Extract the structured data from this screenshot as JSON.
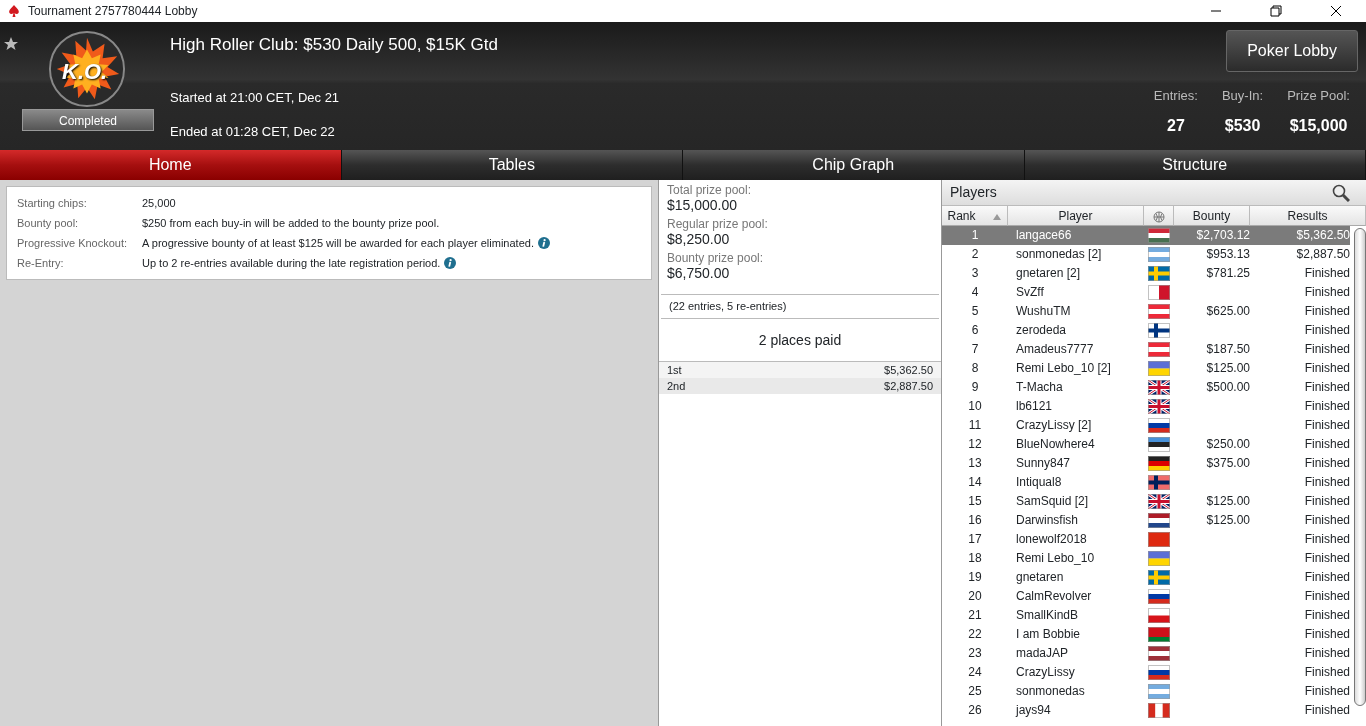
{
  "window": {
    "title": "Tournament 2757780444 Lobby"
  },
  "header": {
    "title": "High Roller Club: $530 Daily 500, $15K Gtd",
    "badge": "K.O.",
    "status": "Completed",
    "started": "Started at 21:00 CET, Dec 21",
    "ended": "Ended at 01:28 CET, Dec 22",
    "lobby_button": "Poker Lobby",
    "stats": [
      {
        "label": "Entries:",
        "value": "27"
      },
      {
        "label": "Buy-In:",
        "value": "$530"
      },
      {
        "label": "Prize Pool:",
        "value": "$15,000"
      }
    ]
  },
  "tabs": [
    {
      "label": "Home",
      "selected": true
    },
    {
      "label": "Tables",
      "selected": false
    },
    {
      "label": "Chip Graph",
      "selected": false
    },
    {
      "label": "Structure",
      "selected": false
    }
  ],
  "info": [
    {
      "label": "Starting chips:",
      "value": "25,000",
      "info_icon": false
    },
    {
      "label": "Bounty pool:",
      "value": "$250 from each buy-in will be added to the bounty prize pool.",
      "info_icon": false
    },
    {
      "label": "Progressive Knockout:",
      "value": "A progressive bounty of at least $125 will be awarded for each player eliminated.",
      "info_icon": true
    },
    {
      "label": "Re-Entry:",
      "value": "Up to 2 re-entries available during the late registration period.",
      "info_icon": true
    }
  ],
  "prizes": {
    "pools": [
      {
        "label": "Total prize pool:",
        "value": "$15,000.00"
      },
      {
        "label": "Regular prize pool:",
        "value": "$8,250.00"
      },
      {
        "label": "Bounty prize pool:",
        "value": "$6,750.00"
      }
    ],
    "entries_note": "(22 entries, 5 re-entries)",
    "places_paid": "2 places paid",
    "payouts": [
      {
        "place": "1st",
        "amount": "$5,362.50"
      },
      {
        "place": "2nd",
        "amount": "$2,887.50"
      }
    ]
  },
  "players": {
    "title": "Players",
    "columns": [
      "Rank",
      "Player",
      "Bounty",
      "Results"
    ],
    "rows": [
      {
        "rank": "1",
        "player": "langace66",
        "bounty": "$2,703.12",
        "result": "$5,362.50",
        "selected": true
      },
      {
        "rank": "2",
        "player": "sonmonedas [2]",
        "bounty": "$953.13",
        "result": "$2,887.50",
        "selected": false
      },
      {
        "rank": "3",
        "player": "gnetaren [2]",
        "bounty": "$781.25",
        "result": "Finished",
        "selected": false
      },
      {
        "rank": "4",
        "player": "SvZff",
        "result": "Finished",
        "selected": false
      },
      {
        "rank": "5",
        "player": "WushuTM",
        "bounty": "$625.00",
        "result": "Finished",
        "selected": false
      },
      {
        "rank": "6",
        "player": "zerodeda",
        "result": "Finished",
        "selected": false
      },
      {
        "rank": "7",
        "player": "Amadeus7777",
        "bounty": "$187.50",
        "result": "Finished",
        "selected": false
      },
      {
        "rank": "8",
        "player": "Remi Lebo_10 [2]",
        "bounty": "$125.00",
        "result": "Finished",
        "selected": false
      },
      {
        "rank": "9",
        "player": "T-Macha",
        "bounty": "$500.00",
        "result": "Finished",
        "selected": false
      },
      {
        "rank": "10",
        "player": "lb6121",
        "result": "Finished",
        "selected": false
      },
      {
        "rank": "11",
        "player": "CrazyLissy [2]",
        "result": "Finished",
        "selected": false
      },
      {
        "rank": "12",
        "player": "BlueNowhere4",
        "bounty": "$250.00",
        "result": "Finished",
        "selected": false
      },
      {
        "rank": "13",
        "player": "Sunny847",
        "bounty": "$375.00",
        "result": "Finished",
        "selected": false
      },
      {
        "rank": "14",
        "player": "Intiqual8",
        "result": "Finished",
        "selected": false
      },
      {
        "rank": "15",
        "player": "SamSquid [2]",
        "bounty": "$125.00",
        "result": "Finished",
        "selected": false
      },
      {
        "rank": "16",
        "player": "Darwinsfish",
        "bounty": "$125.00",
        "result": "Finished",
        "selected": false
      },
      {
        "rank": "17",
        "player": "lonewolf2018",
        "result": "Finished",
        "selected": false
      },
      {
        "rank": "18",
        "player": "Remi Lebo_10",
        "result": "Finished",
        "selected": false
      },
      {
        "rank": "19",
        "player": "gnetaren",
        "result": "Finished",
        "selected": false
      },
      {
        "rank": "20",
        "player": "CalmRevolver",
        "result": "Finished",
        "selected": false
      },
      {
        "rank": "21",
        "player": "SmallKindB",
        "result": "Finished",
        "selected": false
      },
      {
        "rank": "22",
        "player": "I am Bobbie",
        "result": "Finished",
        "selected": false
      },
      {
        "rank": "23",
        "player": "madaJAP",
        "result": "Finished",
        "selected": false
      },
      {
        "rank": "24",
        "player": "CrazyLissy",
        "result": "Finished",
        "selected": false
      },
      {
        "rank": "25",
        "player": "sonmonedas",
        "result": "Finished",
        "selected": false
      },
      {
        "rank": "26",
        "player": "jays94",
        "result": "Finished",
        "selected": false
      }
    ]
  }
}
